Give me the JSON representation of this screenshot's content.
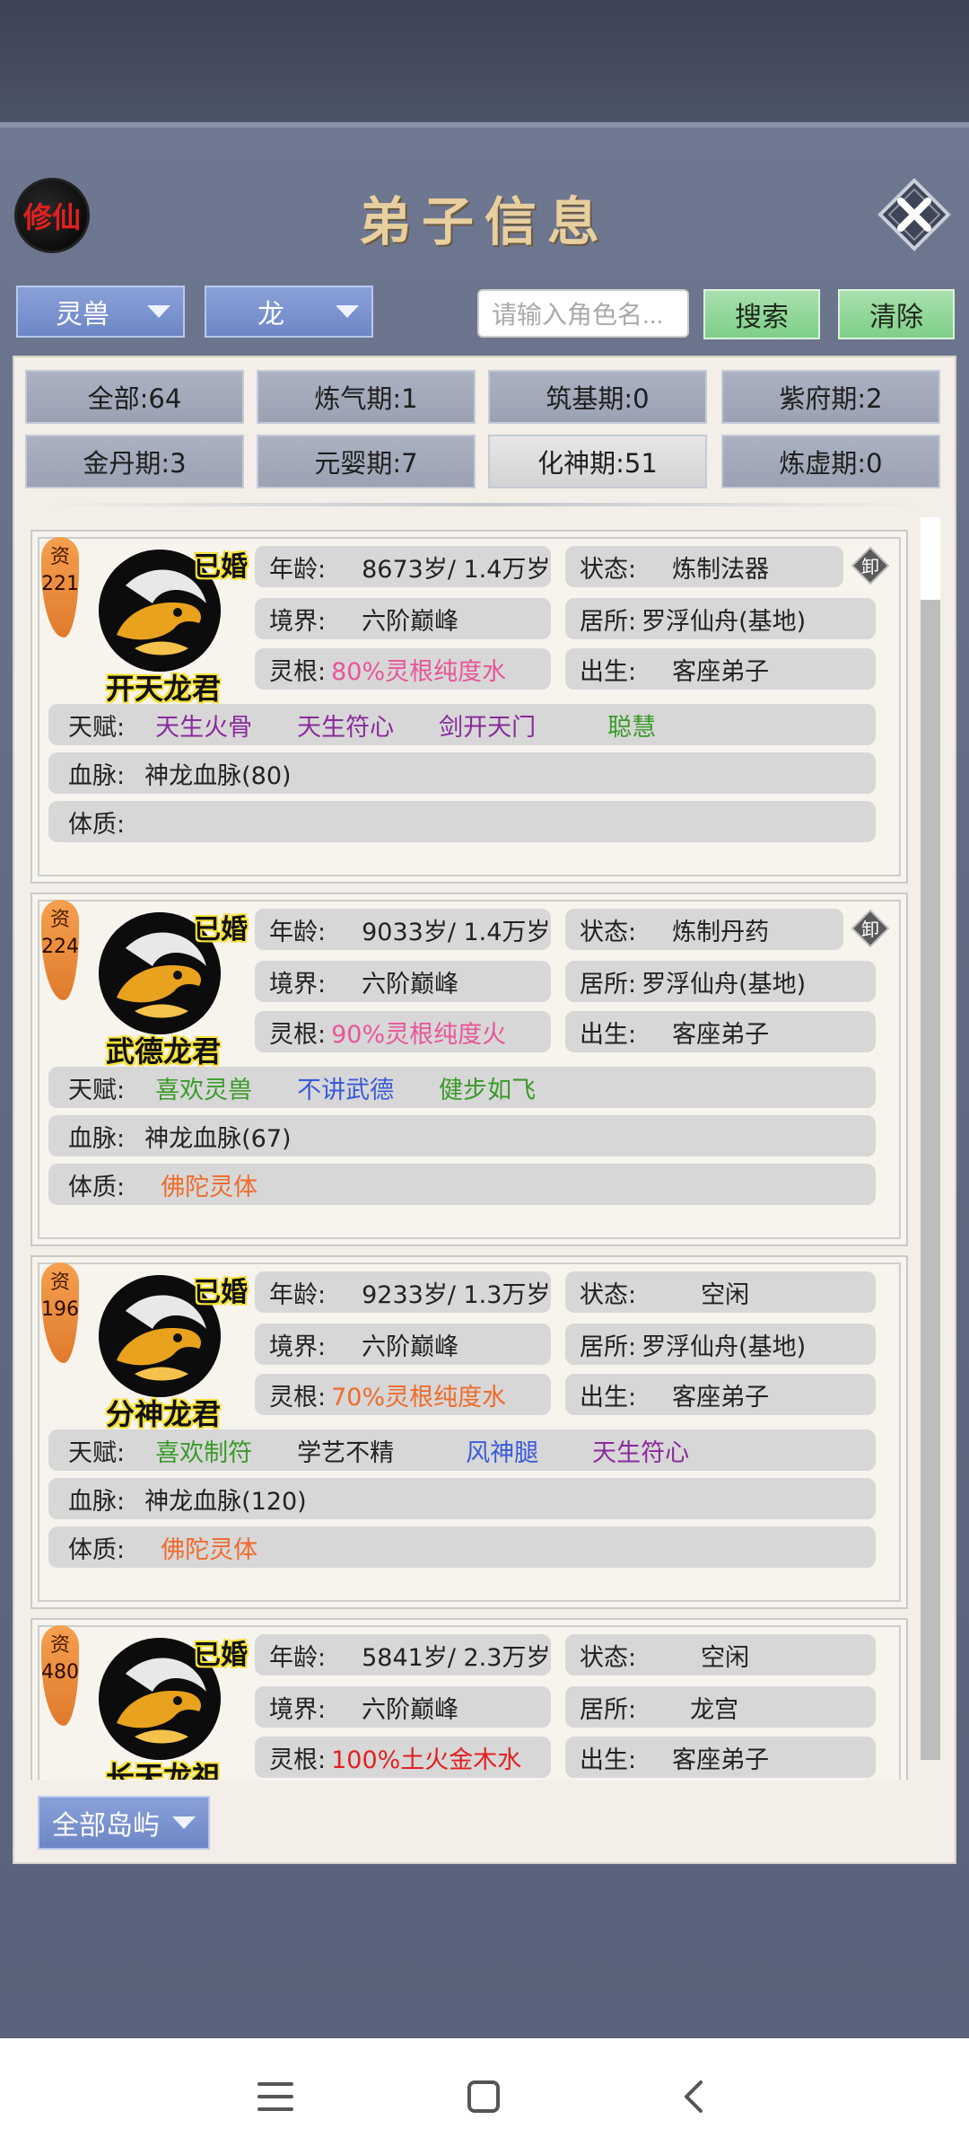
{
  "header": {
    "logo": "修仙",
    "title": "弟子信息"
  },
  "filters": {
    "type_select": "灵兽",
    "species_select": "龙",
    "search_placeholder": "请输入角色名...",
    "search_label": "搜索",
    "clear_label": "清除"
  },
  "realm_tabs": [
    {
      "label": "全部:64"
    },
    {
      "label": "炼气期:1"
    },
    {
      "label": "筑基期:0"
    },
    {
      "label": "紫府期:2"
    },
    {
      "label": "金丹期:3"
    },
    {
      "label": "元婴期:7"
    },
    {
      "label": "化神期:51"
    },
    {
      "label": "炼虚期:0"
    }
  ],
  "labels": {
    "aptitude": "资",
    "married": "已婚",
    "age": "年龄:",
    "status": "状态:",
    "realm": "境界:",
    "residence": "居所:",
    "root": "灵根:",
    "birth": "出生:",
    "talent": "天赋:",
    "bloodline": "血脉:",
    "physique": "体质:",
    "equip": "卸"
  },
  "disciples": [
    {
      "name": "开天龙君",
      "aptitude": "221",
      "age": "8673岁/ 1.4万岁",
      "status": "炼制法器",
      "realm": "六阶巅峰",
      "residence": "罗浮仙舟(基地)",
      "root": "80%灵根纯度水",
      "root_color": "#e8559a",
      "birth": "客座弟子",
      "talents": [
        {
          "text": "天生火骨",
          "color": "purple"
        },
        {
          "text": "天生符心",
          "color": "purple"
        },
        {
          "text": "剑开天门",
          "color": "purple"
        },
        {
          "text": "聪慧",
          "color": "green"
        }
      ],
      "bloodline": "神龙血脉(80)",
      "physique": ""
    },
    {
      "name": "武德龙君",
      "aptitude": "224",
      "age": "9033岁/ 1.4万岁",
      "status": "炼制丹药",
      "realm": "六阶巅峰",
      "residence": "罗浮仙舟(基地)",
      "root": "90%灵根纯度火",
      "root_color": "#e8559a",
      "birth": "客座弟子",
      "talents": [
        {
          "text": "喜欢灵兽",
          "color": "green"
        },
        {
          "text": "不讲武德",
          "color": "blue"
        },
        {
          "text": "健步如飞",
          "color": "green"
        }
      ],
      "bloodline": "神龙血脉(67)",
      "physique": "佛陀灵体"
    },
    {
      "name": "分神龙君",
      "aptitude": "196",
      "age": "9233岁/ 1.3万岁",
      "status": "空闲",
      "realm": "六阶巅峰",
      "residence": "罗浮仙舟(基地)",
      "root": "70%灵根纯度水",
      "root_color": "#f06a2a",
      "birth": "客座弟子",
      "talents": [
        {
          "text": "喜欢制符",
          "color": "green"
        },
        {
          "text": "学艺不精",
          "color": "black"
        },
        {
          "text": "风神腿",
          "color": "blue"
        },
        {
          "text": "天生符心",
          "color": "purple"
        }
      ],
      "bloodline": "神龙血脉(120)",
      "physique": "佛陀灵体"
    },
    {
      "name": "长天龙祖",
      "aptitude": "480",
      "age": "5841岁/ 2.3万岁",
      "status": "空闲",
      "realm": "六阶巅峰",
      "residence": "龙宫",
      "root": "100%土火金木水",
      "root_color": "#e22020",
      "birth": "客座弟子",
      "talents": [],
      "bloodline": "",
      "physique": ""
    }
  ],
  "island_select": "全部岛屿",
  "colors": {
    "frame": "#626b83",
    "dropdown": "#7a92cf",
    "action_green": "#8fd597",
    "panel": "#f3efe8"
  }
}
